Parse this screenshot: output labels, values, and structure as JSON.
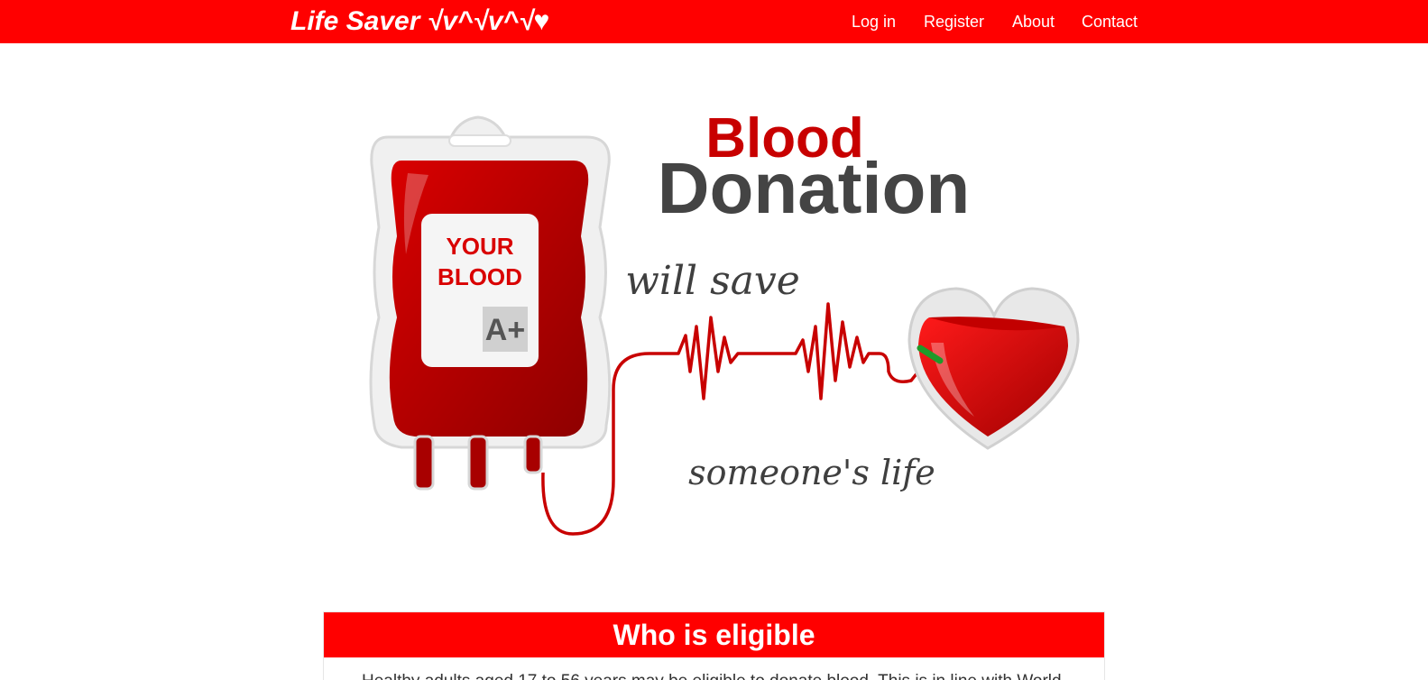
{
  "navbar": {
    "brand": "Life Saver √v^√v^√♥",
    "links": [
      {
        "label": "Log in"
      },
      {
        "label": "Register"
      },
      {
        "label": "About"
      },
      {
        "label": "Contact"
      }
    ]
  },
  "hero": {
    "bag_line1": "YOUR",
    "bag_line2": "BLOOD",
    "blood_type": "A+",
    "title_line1": "Blood",
    "title_line2": "Donation",
    "tagline1": "will save",
    "tagline2": "someone's life"
  },
  "eligibility": {
    "heading": "Who is eligible",
    "text": "Healthy adults aged 17 to 56 years may be eligible to donate blood. This is in line with World"
  },
  "colors": {
    "brand_red": "#ff0000",
    "blood_dark": "#b30000",
    "title_gray": "#444444"
  }
}
